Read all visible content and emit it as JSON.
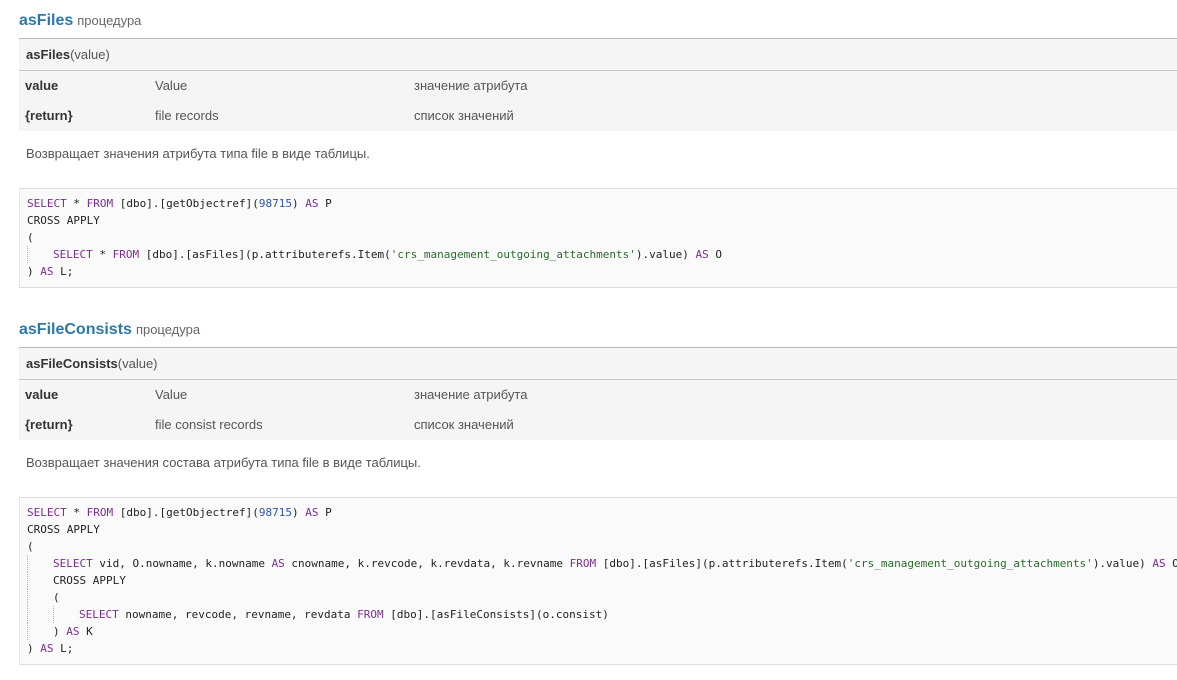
{
  "procedures": [
    {
      "name": "asFiles",
      "kind": "процедура",
      "signature": {
        "name": "asFiles",
        "args": "(value)"
      },
      "params": [
        {
          "name": "value",
          "type": "Value",
          "desc": "значение атрибута"
        },
        {
          "name": "{return}",
          "type": "file records",
          "desc": "список значений"
        }
      ],
      "description": "Возвращает значения атрибута типа file в виде таблицы.",
      "code": [
        {
          "indent": 0,
          "tokens": [
            [
              "kw",
              "SELECT"
            ],
            [
              "p",
              " * "
            ],
            [
              "kw",
              "FROM"
            ],
            [
              "p",
              " [dbo].[getObjectref]("
            ],
            [
              "num",
              "98715"
            ],
            [
              "p",
              ") "
            ],
            [
              "kw",
              "AS"
            ],
            [
              "p",
              " P"
            ]
          ]
        },
        {
          "indent": 0,
          "tokens": [
            [
              "p",
              "CROSS APPLY"
            ]
          ]
        },
        {
          "indent": 0,
          "tokens": [
            [
              "p",
              "("
            ]
          ]
        },
        {
          "indent": 1,
          "tokens": [
            [
              "kw",
              "SELECT"
            ],
            [
              "p",
              " * "
            ],
            [
              "kw",
              "FROM"
            ],
            [
              "p",
              " [dbo].[asFiles](p.attributerefs.Item("
            ],
            [
              "str",
              "'crs_management_outgoing_attachments'"
            ],
            [
              "p",
              ").value) "
            ],
            [
              "kw",
              "AS"
            ],
            [
              "p",
              " O"
            ]
          ]
        },
        {
          "indent": 0,
          "tokens": [
            [
              "p",
              ") "
            ],
            [
              "kw",
              "AS"
            ],
            [
              "p",
              " L;"
            ]
          ]
        }
      ]
    },
    {
      "name": "asFileConsists",
      "kind": "процедура",
      "signature": {
        "name": "asFileConsists",
        "args": "(value)"
      },
      "params": [
        {
          "name": "value",
          "type": "Value",
          "desc": "значение атрибута"
        },
        {
          "name": "{return}",
          "type": "file consist records",
          "desc": "список значений"
        }
      ],
      "description": "Возвращает значения состава атрибута типа file в виде таблицы.",
      "code": [
        {
          "indent": 0,
          "tokens": [
            [
              "kw",
              "SELECT"
            ],
            [
              "p",
              " * "
            ],
            [
              "kw",
              "FROM"
            ],
            [
              "p",
              " [dbo].[getObjectref]("
            ],
            [
              "num",
              "98715"
            ],
            [
              "p",
              ") "
            ],
            [
              "kw",
              "AS"
            ],
            [
              "p",
              " P"
            ]
          ]
        },
        {
          "indent": 0,
          "tokens": [
            [
              "p",
              "CROSS APPLY"
            ]
          ]
        },
        {
          "indent": 0,
          "tokens": [
            [
              "p",
              "("
            ]
          ]
        },
        {
          "indent": 1,
          "tokens": [
            [
              "kw",
              "SELECT"
            ],
            [
              "p",
              " vid, O.nowname, k.nowname "
            ],
            [
              "kw",
              "AS"
            ],
            [
              "p",
              " cnowname, k.revcode, k.revdata, k.revname "
            ],
            [
              "kw",
              "FROM"
            ],
            [
              "p",
              " [dbo].[asFiles](p.attributerefs.Item("
            ],
            [
              "str",
              "'crs_management_outgoing_attachments'"
            ],
            [
              "p",
              ").value) "
            ],
            [
              "kw",
              "AS"
            ],
            [
              "p",
              " O"
            ]
          ]
        },
        {
          "indent": 1,
          "tokens": [
            [
              "p",
              "CROSS APPLY"
            ]
          ]
        },
        {
          "indent": 1,
          "tokens": [
            [
              "p",
              "("
            ]
          ]
        },
        {
          "indent": 2,
          "tokens": [
            [
              "kw",
              "SELECT"
            ],
            [
              "p",
              " nowname, revcode, revname, revdata "
            ],
            [
              "kw",
              "FROM"
            ],
            [
              "p",
              " [dbo].[asFileConsists](o.consist)"
            ]
          ]
        },
        {
          "indent": 1,
          "tokens": [
            [
              "p",
              ") "
            ],
            [
              "kw",
              "AS"
            ],
            [
              "p",
              " K"
            ]
          ]
        },
        {
          "indent": 0,
          "tokens": [
            [
              "p",
              ") "
            ],
            [
              "kw",
              "AS"
            ],
            [
              "p",
              " L;"
            ]
          ]
        }
      ]
    }
  ]
}
